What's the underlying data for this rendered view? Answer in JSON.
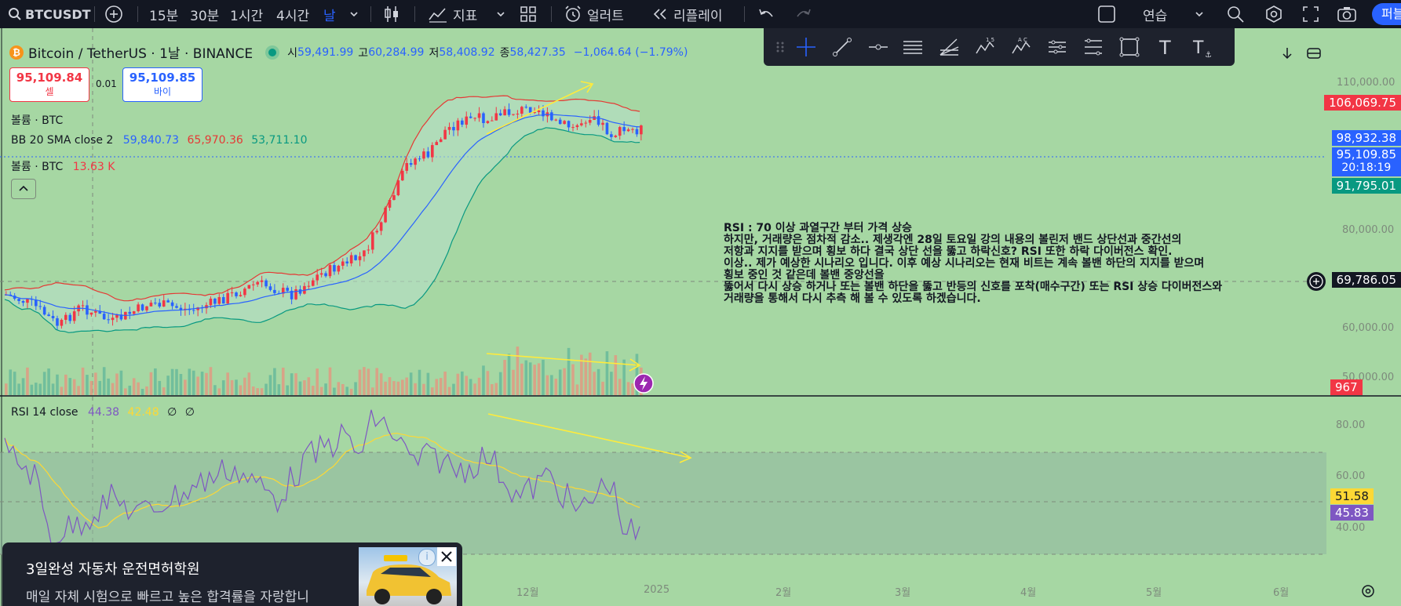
{
  "toolbar": {
    "symbol": "BTCUSDT",
    "intervals": [
      "15분",
      "30분",
      "1시간",
      "4시간",
      "날"
    ],
    "active_interval": "날",
    "indicators_label": "지표",
    "alerts_label": "얼러트",
    "replay_label": "리플레이",
    "layout_label": "연습",
    "publish_label": "퍼블"
  },
  "legend": {
    "title": "Bitcoin / TetherUS · 1날 · BINANCE",
    "open_label": "시",
    "open": "59,491.99",
    "high_label": "고",
    "high": "60,284.99",
    "low_label": "저",
    "low": "58,408.92",
    "close_label": "종",
    "close": "58,427.35",
    "change": "−1,064.64 (−1.79%)",
    "sell_price": "95,109.84",
    "sell_label": "셀",
    "spread": "0.01",
    "buy_price": "95,109.85",
    "buy_label": "바이",
    "volume1": "볼륨 · BTC",
    "bb_label": "BB 20 SMA close 2",
    "bb_basis": "59,840.73",
    "bb_upper": "65,970.36",
    "bb_lower": "53,711.10",
    "volume2": "볼륨 · BTC",
    "volume_value": "13.63 K",
    "rsi_label": "RSI 14 close",
    "rsi_value": "44.38",
    "rsi_ma": "42.48",
    "rsi_extra1": "∅",
    "rsi_extra2": "∅"
  },
  "price_axis": {
    "ticks": [
      "110,000.00",
      "80,000.00",
      "60,000.00",
      "50,000.00"
    ],
    "bb_upper_tag": "106,069.75",
    "bb_basis_tag": "98,932.38",
    "last_price_tag": "95,109.85",
    "countdown": "20:18:19",
    "bb_lower_tag": "91,795.01",
    "crosshair_tag": "69,786.05",
    "volume_tag": "967"
  },
  "rsi_axis": {
    "ticks": [
      "80.00",
      "60.00",
      "40.00"
    ],
    "ma_tag": "51.58",
    "rsi_tag": "45.83"
  },
  "time_axis": [
    "12월",
    "2025",
    "2월",
    "3월",
    "4월",
    "5월",
    "6월"
  ],
  "annotation": [
    "RSI : 70 이상 과열구간 부터 가격 상승",
    "하지만, 거래량은 점차적 감소.. 제생각엔 28일 토요일 강의 내용의 볼린저 밴드 상단선과 중간선의",
    "저항과 지지를 받으며 횡보 하다 결국 상단 선을 뚫고 하락신호? RSI 또한 하락 다이버전스 확인.",
    "이상.. 제가 예상한 시나리오 입니다. 이후 예상 시나리오는 현재 비트는 계속 볼밴 하단의 지지를 받으며",
    "횡보 중인 것 같은데 볼밴 중앙선을",
    "뚫어서 다시 상승 하거나 또는 볼밴 하단을 뚫고 반등의 신호를 포착(매수구간) 또는 RSI 상승 다이버전스와",
    "거래량을 통해서 다시 추측 해 볼 수 있도록 하겠습니다."
  ],
  "ad": {
    "title": "3일완성 자동차 운전면허학원",
    "body": "매일 자체 시험으로 빠르고 높은 합격률을 자랑합니"
  },
  "colors": {
    "background": "#a6d7a3",
    "up": "#f23645",
    "down": "#2962ff",
    "bb_upper": "#e53935",
    "bb_basis": "#2962ff",
    "bb_lower": "#089981",
    "rsi": "#7e57c2",
    "rsi_ma": "#fdd835",
    "arrow": "#ffeb3b"
  },
  "chart_data": {
    "type": "line",
    "series": [
      {
        "name": "BB 20 SMA close 2",
        "values": []
      }
    ]
  }
}
